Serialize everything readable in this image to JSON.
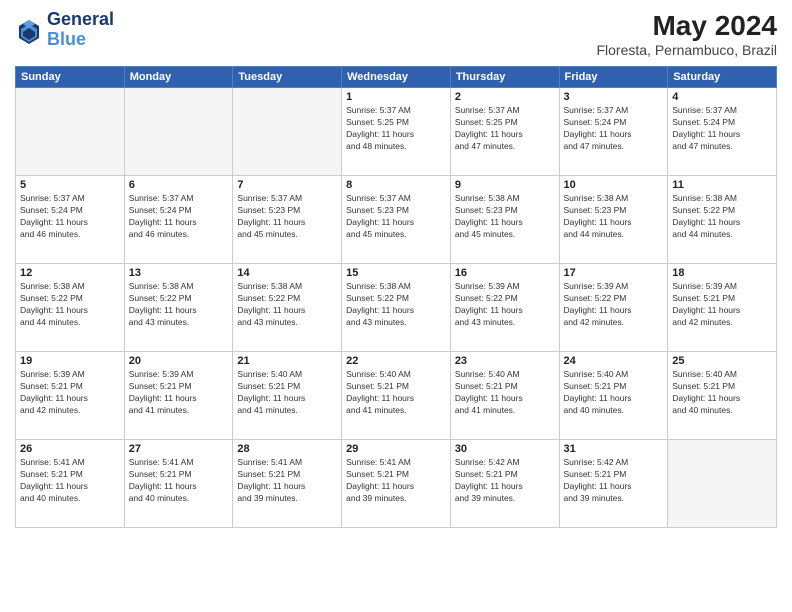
{
  "header": {
    "logo_line1": "General",
    "logo_line2": "Blue",
    "month_year": "May 2024",
    "location": "Floresta, Pernambuco, Brazil"
  },
  "weekdays": [
    "Sunday",
    "Monday",
    "Tuesday",
    "Wednesday",
    "Thursday",
    "Friday",
    "Saturday"
  ],
  "weeks": [
    [
      {
        "day": "",
        "info": ""
      },
      {
        "day": "",
        "info": ""
      },
      {
        "day": "",
        "info": ""
      },
      {
        "day": "1",
        "info": "Sunrise: 5:37 AM\nSunset: 5:25 PM\nDaylight: 11 hours\nand 48 minutes."
      },
      {
        "day": "2",
        "info": "Sunrise: 5:37 AM\nSunset: 5:25 PM\nDaylight: 11 hours\nand 47 minutes."
      },
      {
        "day": "3",
        "info": "Sunrise: 5:37 AM\nSunset: 5:24 PM\nDaylight: 11 hours\nand 47 minutes."
      },
      {
        "day": "4",
        "info": "Sunrise: 5:37 AM\nSunset: 5:24 PM\nDaylight: 11 hours\nand 47 minutes."
      }
    ],
    [
      {
        "day": "5",
        "info": "Sunrise: 5:37 AM\nSunset: 5:24 PM\nDaylight: 11 hours\nand 46 minutes."
      },
      {
        "day": "6",
        "info": "Sunrise: 5:37 AM\nSunset: 5:24 PM\nDaylight: 11 hours\nand 46 minutes."
      },
      {
        "day": "7",
        "info": "Sunrise: 5:37 AM\nSunset: 5:23 PM\nDaylight: 11 hours\nand 45 minutes."
      },
      {
        "day": "8",
        "info": "Sunrise: 5:37 AM\nSunset: 5:23 PM\nDaylight: 11 hours\nand 45 minutes."
      },
      {
        "day": "9",
        "info": "Sunrise: 5:38 AM\nSunset: 5:23 PM\nDaylight: 11 hours\nand 45 minutes."
      },
      {
        "day": "10",
        "info": "Sunrise: 5:38 AM\nSunset: 5:23 PM\nDaylight: 11 hours\nand 44 minutes."
      },
      {
        "day": "11",
        "info": "Sunrise: 5:38 AM\nSunset: 5:22 PM\nDaylight: 11 hours\nand 44 minutes."
      }
    ],
    [
      {
        "day": "12",
        "info": "Sunrise: 5:38 AM\nSunset: 5:22 PM\nDaylight: 11 hours\nand 44 minutes."
      },
      {
        "day": "13",
        "info": "Sunrise: 5:38 AM\nSunset: 5:22 PM\nDaylight: 11 hours\nand 43 minutes."
      },
      {
        "day": "14",
        "info": "Sunrise: 5:38 AM\nSunset: 5:22 PM\nDaylight: 11 hours\nand 43 minutes."
      },
      {
        "day": "15",
        "info": "Sunrise: 5:38 AM\nSunset: 5:22 PM\nDaylight: 11 hours\nand 43 minutes."
      },
      {
        "day": "16",
        "info": "Sunrise: 5:39 AM\nSunset: 5:22 PM\nDaylight: 11 hours\nand 43 minutes."
      },
      {
        "day": "17",
        "info": "Sunrise: 5:39 AM\nSunset: 5:22 PM\nDaylight: 11 hours\nand 42 minutes."
      },
      {
        "day": "18",
        "info": "Sunrise: 5:39 AM\nSunset: 5:21 PM\nDaylight: 11 hours\nand 42 minutes."
      }
    ],
    [
      {
        "day": "19",
        "info": "Sunrise: 5:39 AM\nSunset: 5:21 PM\nDaylight: 11 hours\nand 42 minutes."
      },
      {
        "day": "20",
        "info": "Sunrise: 5:39 AM\nSunset: 5:21 PM\nDaylight: 11 hours\nand 41 minutes."
      },
      {
        "day": "21",
        "info": "Sunrise: 5:40 AM\nSunset: 5:21 PM\nDaylight: 11 hours\nand 41 minutes."
      },
      {
        "day": "22",
        "info": "Sunrise: 5:40 AM\nSunset: 5:21 PM\nDaylight: 11 hours\nand 41 minutes."
      },
      {
        "day": "23",
        "info": "Sunrise: 5:40 AM\nSunset: 5:21 PM\nDaylight: 11 hours\nand 41 minutes."
      },
      {
        "day": "24",
        "info": "Sunrise: 5:40 AM\nSunset: 5:21 PM\nDaylight: 11 hours\nand 40 minutes."
      },
      {
        "day": "25",
        "info": "Sunrise: 5:40 AM\nSunset: 5:21 PM\nDaylight: 11 hours\nand 40 minutes."
      }
    ],
    [
      {
        "day": "26",
        "info": "Sunrise: 5:41 AM\nSunset: 5:21 PM\nDaylight: 11 hours\nand 40 minutes."
      },
      {
        "day": "27",
        "info": "Sunrise: 5:41 AM\nSunset: 5:21 PM\nDaylight: 11 hours\nand 40 minutes."
      },
      {
        "day": "28",
        "info": "Sunrise: 5:41 AM\nSunset: 5:21 PM\nDaylight: 11 hours\nand 39 minutes."
      },
      {
        "day": "29",
        "info": "Sunrise: 5:41 AM\nSunset: 5:21 PM\nDaylight: 11 hours\nand 39 minutes."
      },
      {
        "day": "30",
        "info": "Sunrise: 5:42 AM\nSunset: 5:21 PM\nDaylight: 11 hours\nand 39 minutes."
      },
      {
        "day": "31",
        "info": "Sunrise: 5:42 AM\nSunset: 5:21 PM\nDaylight: 11 hours\nand 39 minutes."
      },
      {
        "day": "",
        "info": ""
      }
    ]
  ]
}
